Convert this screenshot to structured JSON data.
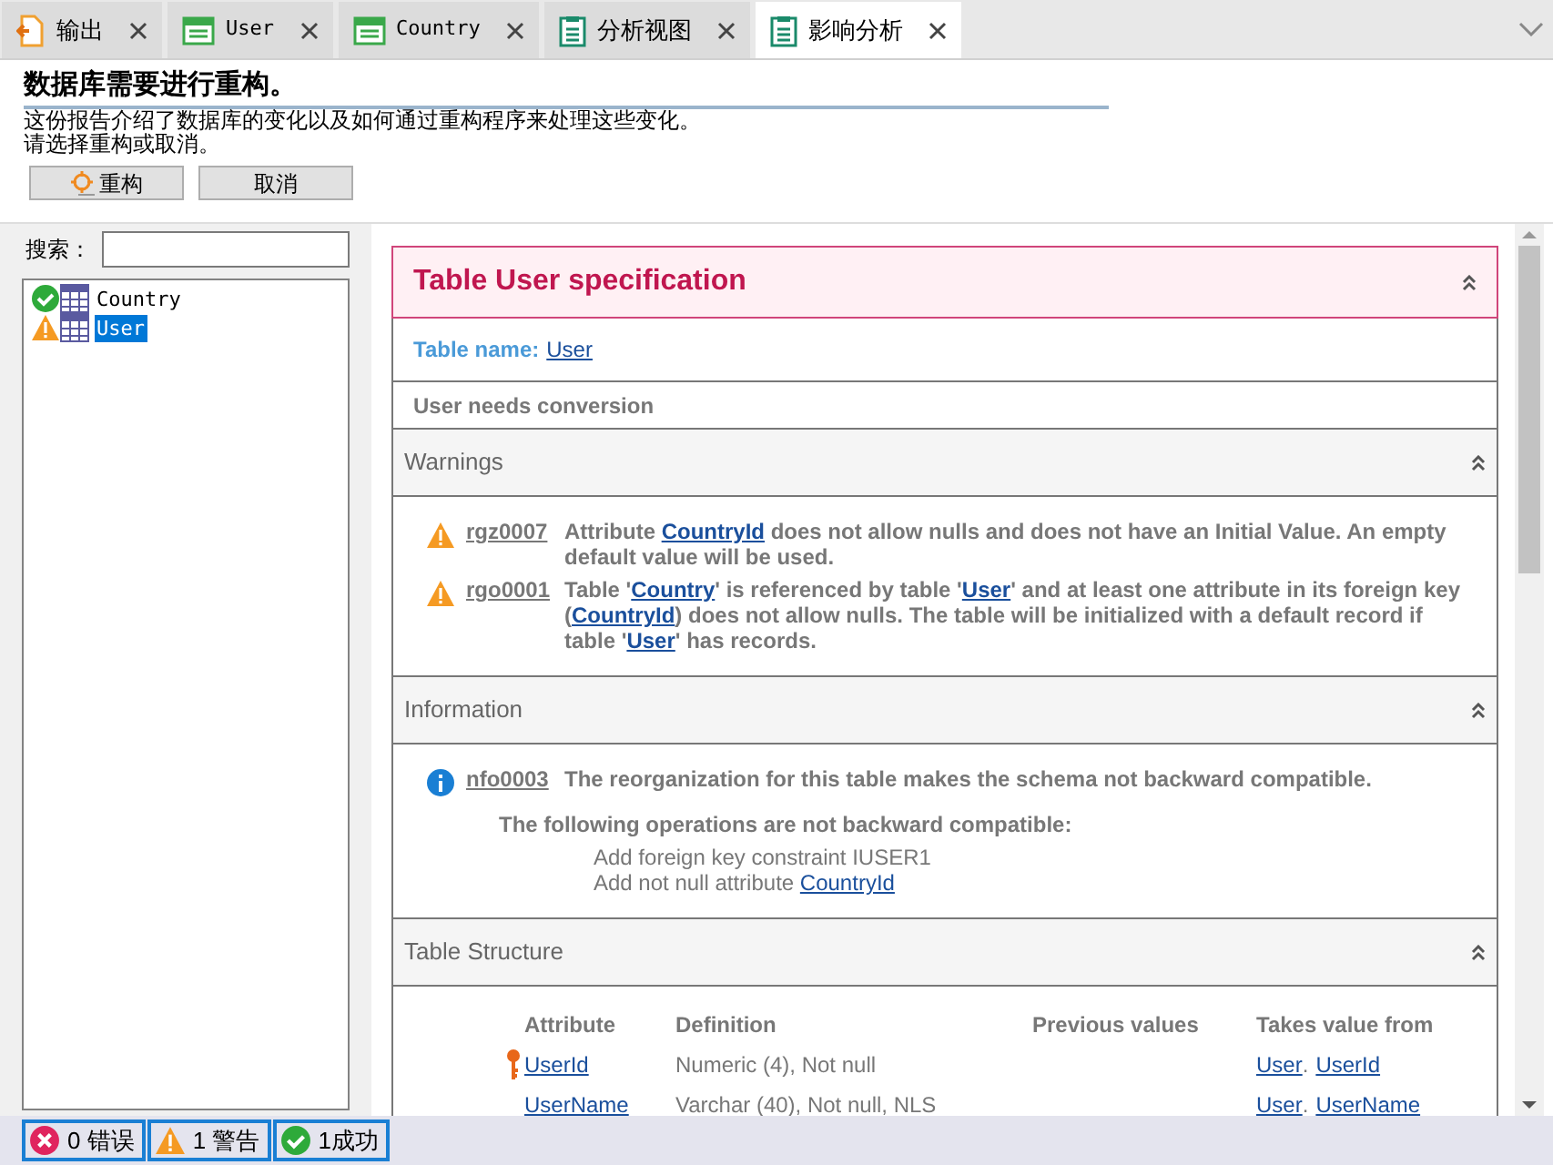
{
  "tabs": [
    {
      "label": "输出",
      "kind": "output",
      "selected": false
    },
    {
      "label": "User",
      "kind": "table",
      "selected": false
    },
    {
      "label": "Country",
      "kind": "table",
      "selected": false
    },
    {
      "label": "分析视图",
      "kind": "view",
      "selected": false
    },
    {
      "label": "影响分析",
      "kind": "view",
      "selected": true
    }
  ],
  "header": {
    "title": "数据库需要进行重构。",
    "description": [
      "这份报告介绍了数据库的变化以及如何通过重构程序来处理这些变化。",
      "请选择重构或取消。"
    ],
    "buttons": [
      {
        "label": "重构",
        "kind": "icon"
      },
      {
        "label": "取消",
        "kind": "plain"
      }
    ]
  },
  "search": {
    "label": "搜索："
  },
  "tree": [
    {
      "label": "Country",
      "kind": "ok",
      "selected": false
    },
    {
      "label": "User",
      "kind": "warning",
      "selected": true
    }
  ],
  "report": {
    "title": "Table User specification",
    "expanded": true,
    "table_name_label": "Table name:",
    "table_name": "User",
    "conversion": "User needs conversion",
    "sections": [
      {
        "kind": "messages",
        "title": "Warnings",
        "expanded": true,
        "messages": [
          {
            "kind": "warning",
            "code": "rgz0007",
            "segments": [
              {
                "text": "Attribute "
              },
              {
                "text": "CountryId",
                "link": true
              },
              {
                "text": " does not allow nulls and does not have an Initial Value. An empty default value will be used."
              }
            ]
          },
          {
            "kind": "warning",
            "code": "rgo0001",
            "segments": [
              {
                "text": "Table '"
              },
              {
                "text": "Country",
                "link": true
              },
              {
                "text": "' is referenced by table '"
              },
              {
                "text": "User",
                "link": true
              },
              {
                "text": "' and at least one attribute in its foreign key ("
              },
              {
                "text": "CountryId",
                "link": true
              },
              {
                "text": ") does not allow nulls. The table will be initialized with a default record if table '"
              },
              {
                "text": "User",
                "link": true
              },
              {
                "text": "' has records."
              }
            ]
          }
        ]
      },
      {
        "kind": "messages",
        "title": "Information",
        "expanded": true,
        "messages": [
          {
            "kind": "info",
            "code": "nfo0003",
            "segments": [
              {
                "text": "The reorganization for this table makes the schema not backward compatible."
              }
            ]
          }
        ],
        "subtitle": "The following operations are not backward compatible:",
        "operations": [
          [
            {
              "text": "Add foreign key constraint IUSER1"
            }
          ],
          [
            {
              "text": "Add not null attribute "
            },
            {
              "text": "CountryId",
              "link": true
            }
          ]
        ]
      },
      {
        "kind": "structure",
        "title": "Table Structure",
        "expanded": true,
        "columns": [
          "Attribute",
          "Definition",
          "Previous values",
          "Takes value from"
        ],
        "rows": [
          {
            "key": true,
            "attribute": "UserId",
            "definition": "Numeric (4), Not null",
            "source_table": "User",
            "separator": ".",
            "source_attribute": "UserId"
          },
          {
            "key": false,
            "attribute": "UserName",
            "definition": "Varchar (40), Not null, NLS",
            "source_table": "User",
            "separator": ".",
            "source_attribute": "UserName"
          }
        ]
      }
    ]
  },
  "status_bar": [
    {
      "kind": "error",
      "label": "0 错误"
    },
    {
      "kind": "warning",
      "label": "1 警告"
    },
    {
      "kind": "ok",
      "label": "1成功"
    }
  ]
}
